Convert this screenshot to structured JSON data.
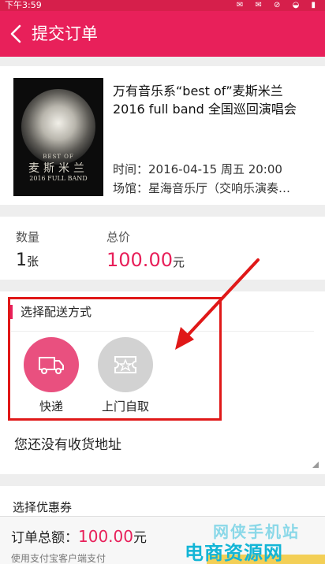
{
  "status_bar": {
    "time": "下午3:59"
  },
  "header": {
    "title": "提交订单"
  },
  "event": {
    "name": "万有音乐系“best of”麦斯米兰 2016 full band 全国巡回演唱会",
    "time": "时间：2016-04-15 周五 20:00",
    "venue": "场馆：星海音乐厅（交响乐演奏…",
    "poster": {
      "text_best_of": "BEST OF",
      "text_name": "麦斯米兰",
      "text_band": "2016 FULL BAND"
    }
  },
  "order": {
    "quantity_label": "数量",
    "quantity_value": "1",
    "quantity_unit": "张",
    "total_label": "总价",
    "total_value": "100.00",
    "total_unit": "元"
  },
  "delivery": {
    "title": "选择配送方式",
    "options": [
      {
        "label": "快递",
        "icon": "truck-icon",
        "selected": true
      },
      {
        "label": "上门自取",
        "icon": "ticket-icon",
        "selected": false
      }
    ]
  },
  "address": {
    "text": "您还没有收货地址"
  },
  "coupon": {
    "label": "选择优惠券"
  },
  "footer": {
    "total_label": "订单总额：",
    "total_value": "100.00",
    "total_unit": "元",
    "payment_note": "使用支付宝客户端支付"
  },
  "watermark": {
    "line1": "网侠手机站",
    "line2": "电商资源网"
  },
  "colors": {
    "accent": "#e8205a",
    "annotation": "#e01818",
    "selected_option": "#e9507f",
    "unselected_option": "#d2d2d2"
  }
}
